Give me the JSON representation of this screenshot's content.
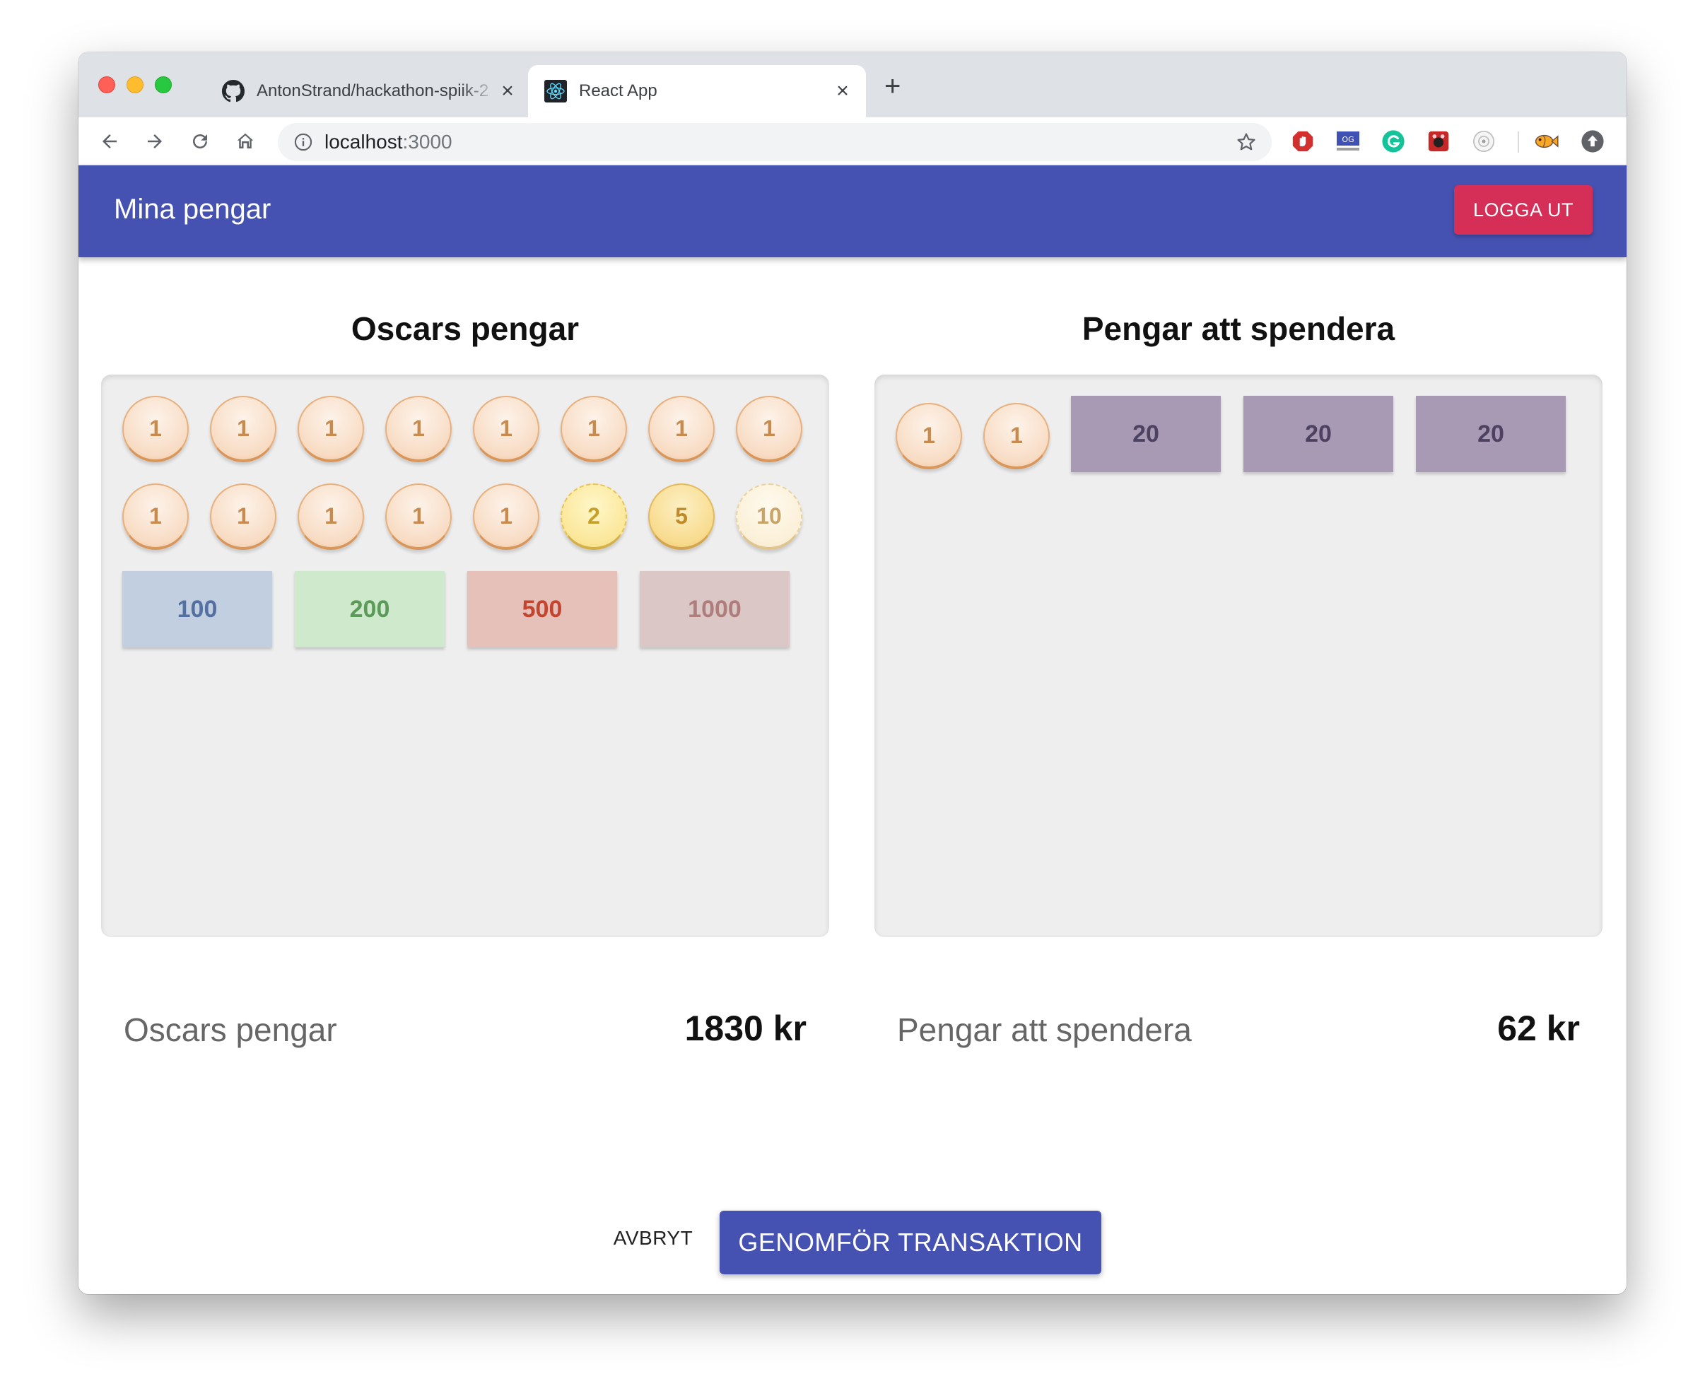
{
  "browser": {
    "tabs": [
      {
        "title": "AntonStrand/hackathon-spiik-2",
        "favicon": "github-icon",
        "active": false
      },
      {
        "title": "React App",
        "favicon": "react-icon",
        "active": true
      }
    ],
    "url_host": "localhost",
    "url_port": ":3000"
  },
  "app": {
    "title": "Mina pengar",
    "logout_label": "LOGGA UT"
  },
  "left": {
    "title": "Oscars pengar",
    "coins_row1": [
      "1",
      "1",
      "1",
      "1",
      "1",
      "1",
      "1",
      "1"
    ],
    "coins_row2": [
      "1",
      "1",
      "1",
      "1",
      "1",
      "2",
      "5",
      "10"
    ],
    "notes": [
      "100",
      "200",
      "500",
      "1000"
    ],
    "sum_label": "Oscars pengar",
    "sum_value": "1830 kr"
  },
  "right": {
    "title": "Pengar att spendera",
    "coins": [
      "1",
      "1"
    ],
    "notes": [
      "20",
      "20",
      "20"
    ],
    "sum_label": "Pengar att spendera",
    "sum_value": "62 kr"
  },
  "actions": {
    "cancel_label": "AVBRYT",
    "submit_label": "GENOMFÖR TRANSAKTION"
  },
  "colors": {
    "appbar": "#4652b1",
    "logout": "#d62f57",
    "submit": "#4652b1"
  }
}
